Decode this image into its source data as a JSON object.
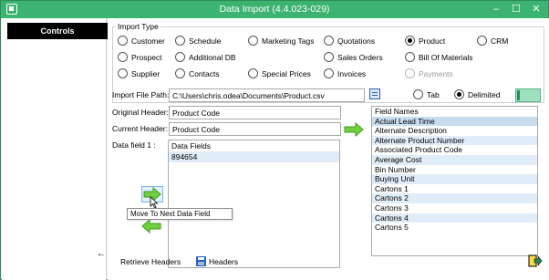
{
  "window": {
    "title": "Data Import (4.4.023-029)",
    "controls": {
      "minimize": "–",
      "maximize": "☐",
      "close": "✕"
    },
    "accent": "#3cb371"
  },
  "sidebar": {
    "controls_label": "Controls",
    "back_icon": "left-arrow-icon"
  },
  "import_type": {
    "title": "Import Type",
    "options": [
      {
        "label": "Customer",
        "checked": false,
        "disabled": false
      },
      {
        "label": "Schedule",
        "checked": false,
        "disabled": false
      },
      {
        "label": "Marketing Tags",
        "checked": false,
        "disabled": false
      },
      {
        "label": "Quotations",
        "checked": false,
        "disabled": false
      },
      {
        "label": "Product",
        "checked": true,
        "disabled": false
      },
      {
        "label": "CRM",
        "checked": false,
        "disabled": false
      },
      {
        "label": "Prospect",
        "checked": false,
        "disabled": false
      },
      {
        "label": "Additional DB",
        "checked": false,
        "disabled": false
      },
      {
        "label": "Sales Orders",
        "checked": false,
        "disabled": false
      },
      {
        "label": "Bill Of Materials",
        "checked": false,
        "disabled": false
      },
      {
        "label": "Supplier",
        "checked": false,
        "disabled": false
      },
      {
        "label": "Contacts",
        "checked": false,
        "disabled": false
      },
      {
        "label": "Special Prices",
        "checked": false,
        "disabled": false
      },
      {
        "label": "Invoices",
        "checked": false,
        "disabled": false
      },
      {
        "label": "Payments",
        "checked": false,
        "disabled": true
      }
    ]
  },
  "file": {
    "label": "Import File Path:",
    "path": "C:\\Users\\chris.odea\\Documents\\Product.csv",
    "delimiter_options": [
      {
        "label": "Tab",
        "checked": false
      },
      {
        "label": "Delimited",
        "checked": true
      }
    ]
  },
  "headers": {
    "original_label": "Original Header:",
    "original_value": "Product Code",
    "current_label": "Current Header:",
    "current_value": "Product Code"
  },
  "data_field": {
    "label": "Data field 1 :",
    "column_header": "Data Fields",
    "values": [
      "894654"
    ]
  },
  "field_names": {
    "header": "Field Names",
    "items": [
      "Actual Lead Time",
      "Alternate Description",
      "Alternate Product Number",
      "Associated Product Code",
      "Average Cost",
      "Bin Number",
      "Buying Unit",
      "Cartons 1",
      "Cartons 2",
      "Cartons 3",
      "Cartons 4",
      "Cartons 5"
    ]
  },
  "tooltip": {
    "text": "Move To Next Data Field"
  },
  "footer": {
    "retrieve_headers": "Retrieve Headers",
    "headers": "Headers",
    "exit_icon": "exit-icon"
  }
}
